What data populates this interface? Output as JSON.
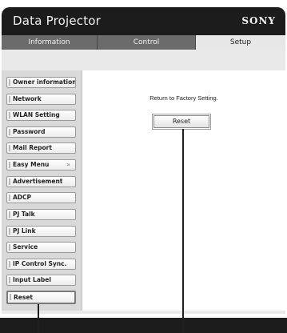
{
  "header": {
    "title": "Data Projector",
    "brand": "SONY"
  },
  "tabs": [
    {
      "label": "Information",
      "selected": false
    },
    {
      "label": "Control",
      "selected": false
    },
    {
      "label": "Setup",
      "selected": true
    }
  ],
  "sidebar": {
    "items": [
      {
        "label": "Owner information"
      },
      {
        "label": "Network"
      },
      {
        "label": "WLAN Setting"
      },
      {
        "label": "Password"
      },
      {
        "label": "Mail Report"
      },
      {
        "label": "Easy Menu",
        "chevron": "»"
      },
      {
        "label": "Advertisement"
      },
      {
        "label": "ADCP"
      },
      {
        "label": "PJ Talk"
      },
      {
        "label": "PJ Link"
      },
      {
        "label": "Service"
      },
      {
        "label": "IP Control Sync."
      },
      {
        "label": "Input Label"
      },
      {
        "label": "Reset",
        "selected": true
      }
    ]
  },
  "main": {
    "message": "Return to Factory Setting.",
    "reset_label": "Reset"
  }
}
